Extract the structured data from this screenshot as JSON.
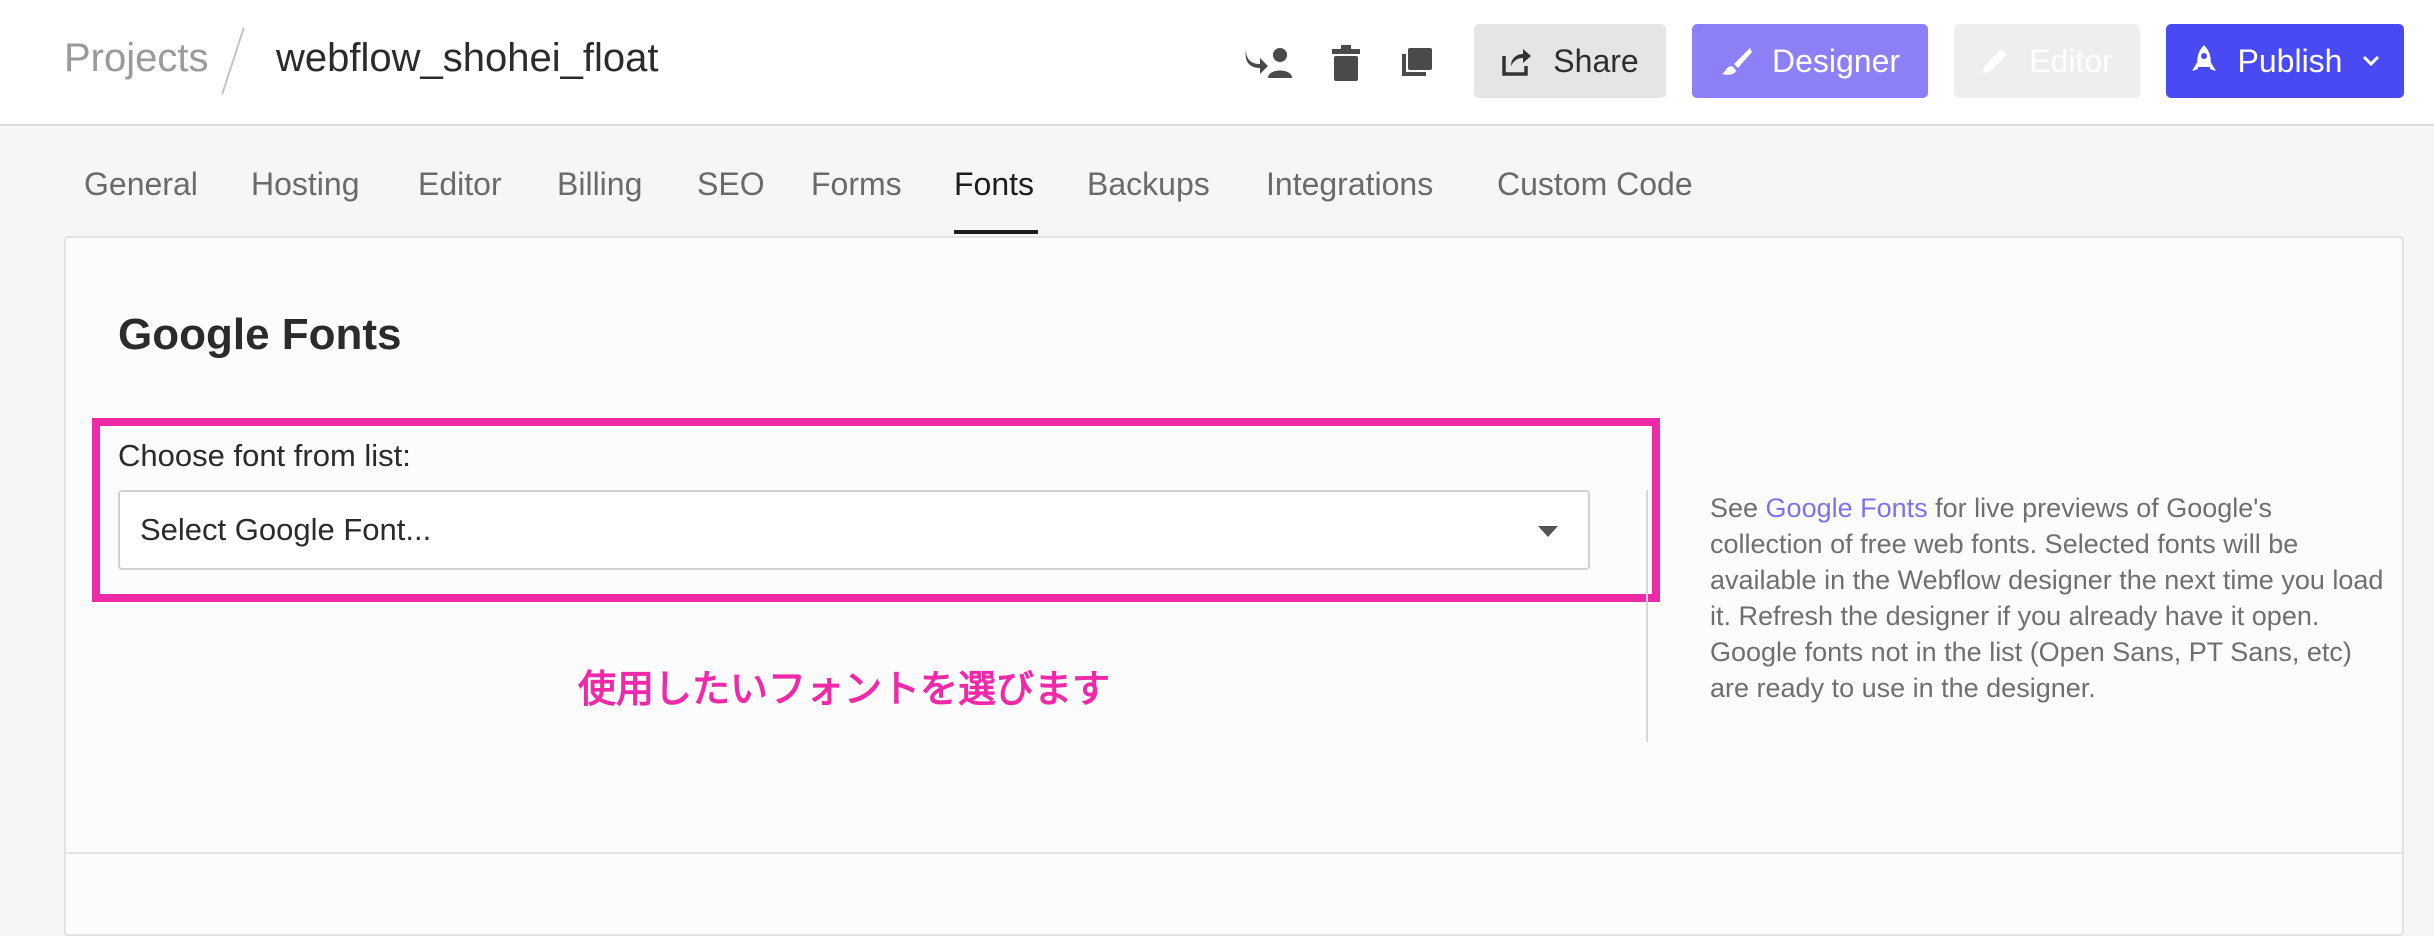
{
  "header": {
    "breadcrumb_root": "Projects",
    "project_name": "webflow_shohei_float",
    "icons": [
      "transfer-user-icon",
      "trash-icon",
      "duplicate-icon"
    ],
    "buttons": {
      "share": "Share",
      "designer": "Designer",
      "editor": "Editor",
      "publish": "Publish"
    }
  },
  "tabs": [
    {
      "label": "General"
    },
    {
      "label": "Hosting"
    },
    {
      "label": "Editor"
    },
    {
      "label": "Billing"
    },
    {
      "label": "SEO"
    },
    {
      "label": "Forms"
    },
    {
      "label": "Fonts",
      "active": true
    },
    {
      "label": "Backups"
    },
    {
      "label": "Integrations"
    },
    {
      "label": "Custom Code"
    }
  ],
  "fonts_panel": {
    "title": "Google Fonts",
    "field_label": "Choose font from list:",
    "select_placeholder": "Select Google Font...",
    "annotation": "使用したいフォントを選びます",
    "help": {
      "prefix": "See ",
      "link": "Google Fonts",
      "suffix": " for live previews of Google's collection of free web fonts. Selected fonts will be available in the Webflow designer the next time you load it. Refresh the designer if you already have it open. Google fonts not in the list (Open Sans, PT Sans, etc) are ready to use in the designer."
    }
  },
  "colors": {
    "accent_designer": "#8b80f5",
    "accent_publish": "#4a4af4",
    "annotation_magenta": "#ee2aa9",
    "link": "#7b74e8"
  }
}
